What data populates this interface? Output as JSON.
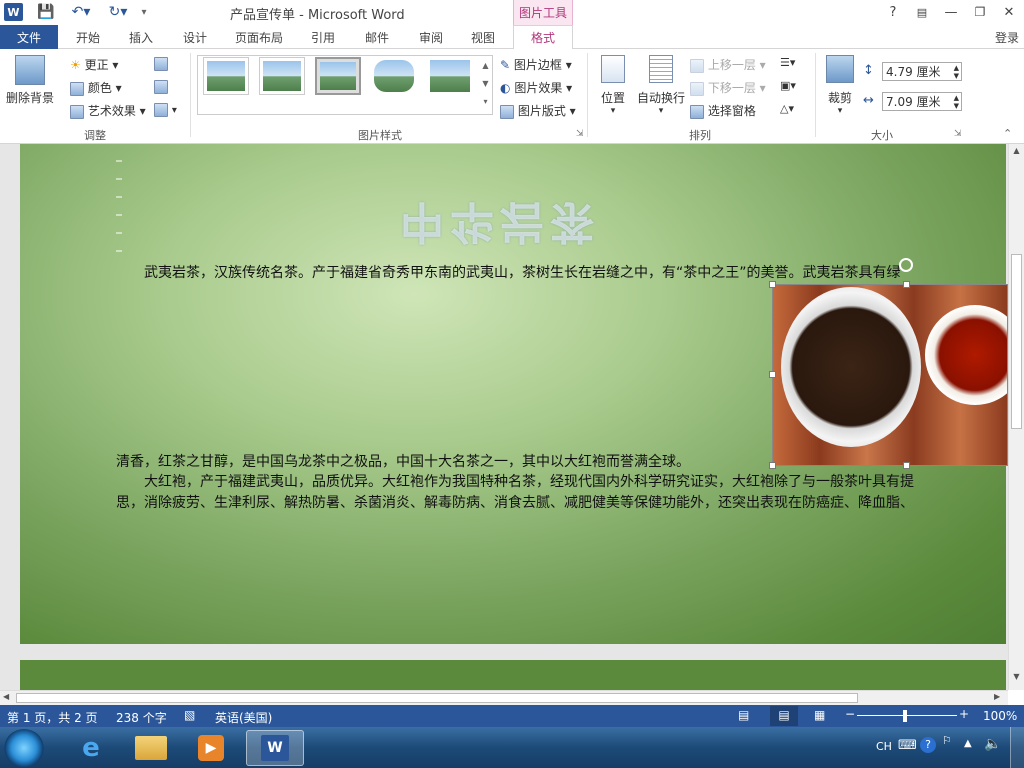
{
  "titlebar": {
    "doc_title": "产品宣传单 - Microsoft Word",
    "context_tab": "图片工具",
    "help": "?",
    "login": "登录"
  },
  "tabs": [
    "文件",
    "开始",
    "插入",
    "设计",
    "页面布局",
    "引用",
    "邮件",
    "审阅",
    "视图",
    "格式"
  ],
  "ribbon": {
    "adjust": {
      "remove_bg": "删除背景",
      "corrections": "更正",
      "color": "颜色",
      "artistic": "艺术效果",
      "label": "调整"
    },
    "styles": {
      "label": "图片样式",
      "border": "图片边框",
      "effects": "图片效果",
      "layout": "图片版式"
    },
    "arrange": {
      "position": "位置",
      "wrap": "自动换行",
      "bring_forward": "上移一层",
      "send_backward": "下移一层",
      "selection_pane": "选择窗格",
      "label": "排列"
    },
    "size": {
      "crop": "裁剪",
      "height": "4.79 厘米",
      "width": "7.09 厘米",
      "label": "大小"
    }
  },
  "document": {
    "wordart": "中华岩茶",
    "para1": "武夷岩茶，汉族传统名茶。产于福建省奇秀甲东南的武夷山，茶树生长在岩缝之中，有“茶中之王”的美誉。武夷岩茶具有绿",
    "para1_cont": "清香，红茶之甘醇，是中国乌龙茶中之极品，中国十大名茶之一，其中以大红袍而誉满全球。",
    "para2": "大红袍，产于福建武夷山，品质优异。大红袍作为我国特种名茶，经现代国内外科学研究证实，大红袍除了与一般茶叶具有提",
    "para3": "思，消除疲劳、生津利尿、解热防暑、杀菌消炎、解毒防病、消食去腻、减肥健美等保健功能外，还突出表现在防癌症、降血脂、"
  },
  "statusbar": {
    "page": "第 1 页，共 2 页",
    "words": "238 个字",
    "lang": "英语(美国)",
    "zoom": "100%"
  },
  "taskbar": {
    "lang": "CH"
  },
  "colors": {
    "word_blue": "#2b579a",
    "picture_tools_accent": "#b1357a"
  }
}
